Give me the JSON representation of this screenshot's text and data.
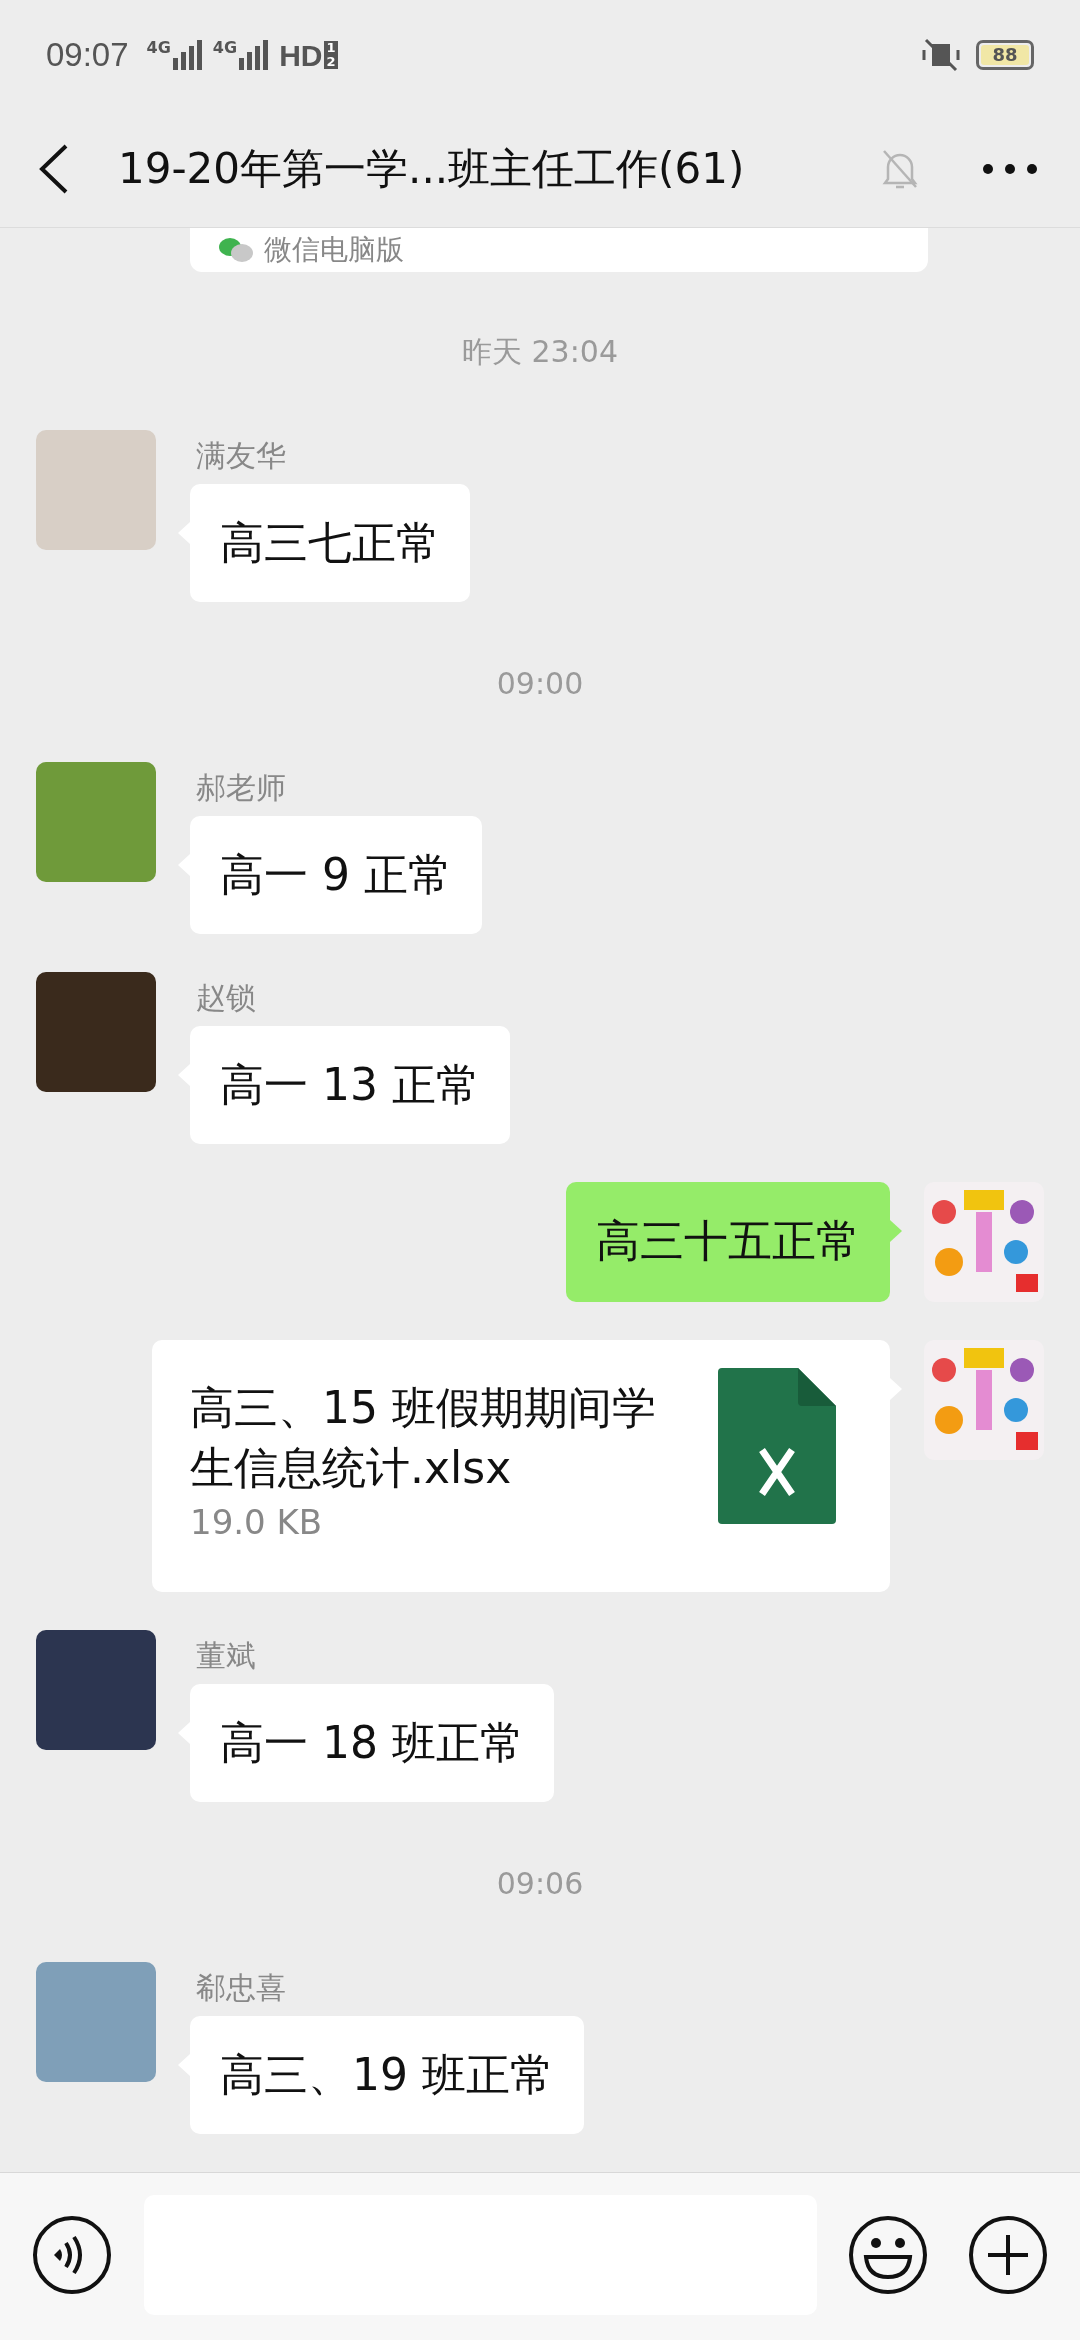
{
  "status_bar": {
    "time": "09:07",
    "networks": [
      "4G",
      "4G"
    ],
    "hd": "HD",
    "sims": [
      "1",
      "2"
    ],
    "battery": "88"
  },
  "header": {
    "title": "19-20年第一学...班主任工作(61)",
    "muted": true
  },
  "pinned_card": {
    "text": "微信电脑版"
  },
  "messages": [
    {
      "kind": "time",
      "text": "昨天 23:04"
    },
    {
      "kind": "incoming",
      "sender": "满友华",
      "text": "高三七正常"
    },
    {
      "kind": "time",
      "text": "09:00"
    },
    {
      "kind": "incoming",
      "sender": "郝老师",
      "text": "高一 9 正常"
    },
    {
      "kind": "incoming",
      "sender": "赵锁",
      "text": "高一 13 正常"
    },
    {
      "kind": "outgoing",
      "text": "高三十五正常"
    },
    {
      "kind": "file",
      "name": "高三、15 班假期期间学生信息统计.xlsx",
      "size": "19.0 KB"
    },
    {
      "kind": "incoming",
      "sender": "董斌",
      "text": "高一 18 班正常"
    },
    {
      "kind": "time",
      "text": "09:06"
    },
    {
      "kind": "incoming",
      "sender": "郗忠喜",
      "text": "高三、19 班正常"
    }
  ]
}
